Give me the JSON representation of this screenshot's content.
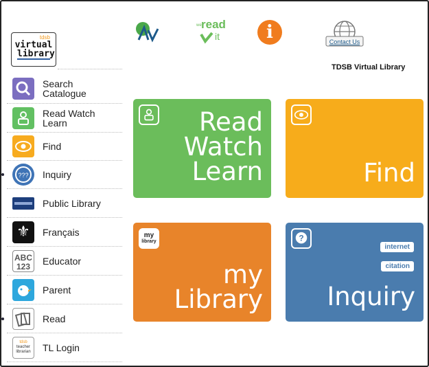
{
  "logo": {
    "small_text": "tdsb",
    "line1": "virtual",
    "line2": "library"
  },
  "sidebar": {
    "items": [
      {
        "label_line1": "Search",
        "label_line2": "Catalogue",
        "icon": "search-icon",
        "color": "#7b6ec0"
      },
      {
        "label_line1": "Read Watch",
        "label_line2": "Learn",
        "icon": "reader-icon",
        "color": "#62c062"
      },
      {
        "label_line1": "Find",
        "label_line2": "",
        "icon": "eye-icon",
        "color": "#f7ab1f"
      },
      {
        "label_line1": "Inquiry",
        "label_line2": "",
        "icon": "question-icon",
        "color": "#3f74b6"
      },
      {
        "label_line1": "Public Library",
        "label_line2": "",
        "icon": "library-icon",
        "color": "#1d3e7c"
      },
      {
        "label_line1": "Français",
        "label_line2": "",
        "icon": "fleur-de-lis-icon",
        "color": "#111111"
      },
      {
        "label_line1": "Educator",
        "label_line2": "",
        "icon": "abc-icon",
        "color": "#666666"
      },
      {
        "label_line1": "Parent",
        "label_line2": "",
        "icon": "bird-icon",
        "color": "#2ea7dd"
      },
      {
        "label_line1": "Read",
        "label_line2": "",
        "icon": "books-icon",
        "color": "#888888"
      },
      {
        "label_line1": "TL Login",
        "label_line2": "",
        "icon": "teacher-librarian-icon",
        "color": "#444444",
        "icon_text_top": "tdsb",
        "icon_text_mid": "teacher",
        "icon_text_bot": "librarian"
      }
    ]
  },
  "header": {
    "readit_small": "we",
    "readit_big": "read",
    "readit_sub": "it",
    "info_symbol": "i",
    "contact_label": "Contact Us",
    "caption": "TDSB Virtual Library"
  },
  "tiles": {
    "read_watch_learn": {
      "line1": "Read",
      "line2": "Watch",
      "line3": "Learn",
      "color": "#6bbd5b"
    },
    "find": {
      "line1": "Find",
      "color": "#f7ac1b"
    },
    "my_library": {
      "line1": "my",
      "line2": "Library",
      "icon_line1": "my",
      "icon_line2": "library",
      "color": "#e8842a"
    },
    "inquiry": {
      "line1": "Inquiry",
      "pill1": "internet",
      "pill2": "citation",
      "color": "#4a7cae"
    }
  }
}
